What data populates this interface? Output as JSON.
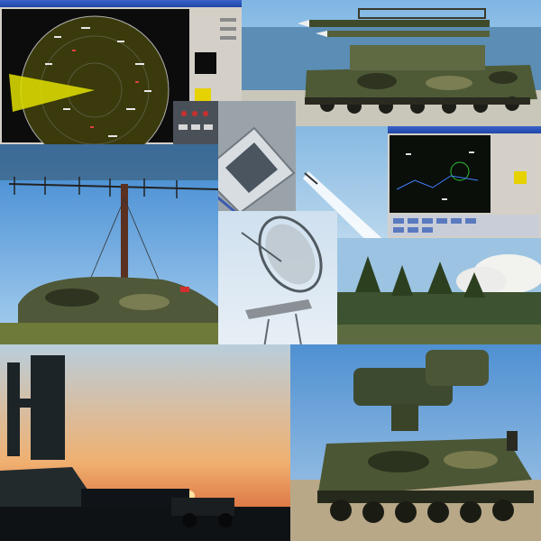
{
  "scene": {
    "description_free": true,
    "panels": [
      {
        "id": "radar-display-window",
        "subject": "radar-ppi-screen"
      },
      {
        "id": "missile-launcher-vehicle",
        "subject": "tracked-launcher"
      },
      {
        "id": "operator-console-closeup",
        "subject": "console"
      },
      {
        "id": "missile-launch-sky",
        "subject": "missile-launch"
      },
      {
        "id": "tactical-display-window",
        "subject": "tactical-display"
      },
      {
        "id": "antenna-array-field",
        "subject": "antenna-mast"
      },
      {
        "id": "parabolic-radar-tower",
        "subject": "dish-antenna"
      },
      {
        "id": "forest-smoke",
        "subject": "launch-smoke"
      },
      {
        "id": "control-room",
        "subject": "workstations"
      },
      {
        "id": "sunset-radar-silhouette",
        "subject": "radar-silhouette"
      },
      {
        "id": "tracked-radar-vehicle",
        "subject": "radar-vehicle"
      }
    ]
  },
  "colors": {
    "sky": "#8ec1e8",
    "sea": "#5b8db5",
    "camo": "#5a6440",
    "radar_bg": "#0c0c0c",
    "radar_sweep": "#e2e000",
    "window_chrome": "#d4d0c8",
    "titlebar": "#2a56c0",
    "sunset": "#f08a3a"
  }
}
